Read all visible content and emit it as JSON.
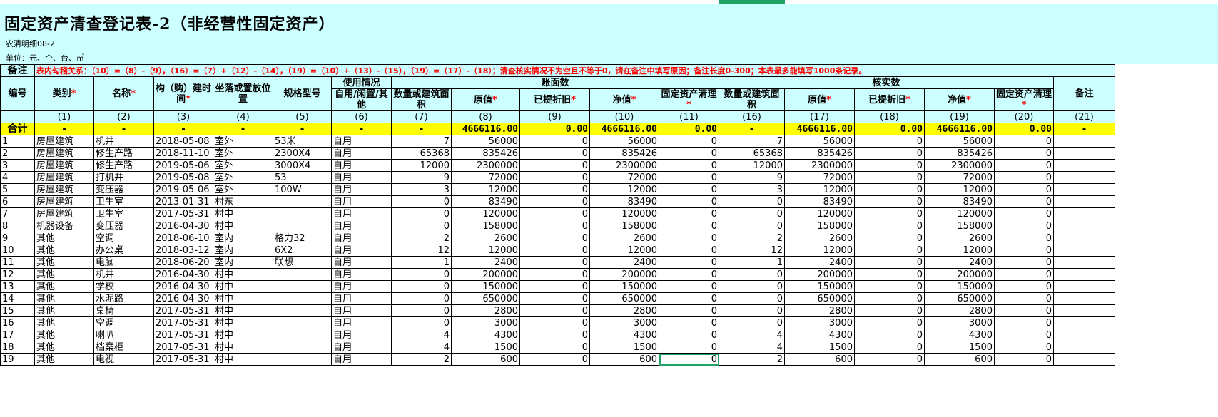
{
  "sheet": {
    "title": "固定资产清查登记表-2（非经营性固定资产）",
    "code": "农清明细08-2",
    "unit": "单位：元、个、台、㎡",
    "note_label": "备注",
    "note_text": "表内勾稽关系：（10）=（8）-（9），（16）=（7）+（12）-（14），（19）=（10）+（13）-（15），（19）=（17）-（18）；清查核实情况不为空且不等于0，请在备注中填写原因；备注长度0-300；本表最多能填写1000条记录。"
  },
  "headers": {
    "no": "编号",
    "category": "类别",
    "name": "名称",
    "build_time": "构（购）建时间",
    "location": "坐落或置放位置",
    "spec": "规格型号",
    "usage_group": "使用情况",
    "usage": "自用/闲置/其他",
    "book_group": "账面数",
    "verify_group": "核实数",
    "qty_book": "数量或建筑面积",
    "orig_book": "原值",
    "dep_book": "已提折旧",
    "net_book": "净值",
    "clean_book": "固定资产清理",
    "qty_ver": "数量或建筑面积",
    "orig_ver": "原值",
    "dep_ver": "已提折旧",
    "net_ver": "净值",
    "clean_ver": "固定资产清理",
    "remark": "备注",
    "star": "*"
  },
  "col_numbers": [
    "",
    "(1)",
    "(2)",
    "(3)",
    "(4)",
    "(5)",
    "(6)",
    "(7)",
    "(8)",
    "(9)",
    "(10)",
    "(11)",
    "(16)",
    "(17)",
    "(18)",
    "(19)",
    "(20)",
    "(21)"
  ],
  "total_row": [
    "合计",
    "-",
    "-",
    "-",
    "-",
    "-",
    "-",
    "-",
    "4666116.00",
    "0.00",
    "4666116.00",
    "0.00",
    "-",
    "4666116.00",
    "0.00",
    "4666116.00",
    "0.00",
    "-"
  ],
  "rows": [
    [
      "1",
      "房屋建筑",
      "机井",
      "2018-05-08",
      "室外",
      "53米",
      "自用",
      "7",
      "56000",
      "0",
      "56000",
      "0",
      "7",
      "56000",
      "0",
      "56000",
      "0",
      ""
    ],
    [
      "2",
      "房屋建筑",
      "修生产路",
      "2018-11-10",
      "室外",
      "2300X4",
      "自用",
      "65368",
      "835426",
      "0",
      "835426",
      "0",
      "65368",
      "835426",
      "0",
      "835426",
      "0",
      ""
    ],
    [
      "3",
      "房屋建筑",
      "修生产路",
      "2019-05-06",
      "室外",
      "3000X4",
      "自用",
      "12000",
      "2300000",
      "0",
      "2300000",
      "0",
      "12000",
      "2300000",
      "0",
      "2300000",
      "0",
      ""
    ],
    [
      "4",
      "房屋建筑",
      "打机井",
      "2019-05-08",
      "室外",
      "53",
      "自用",
      "9",
      "72000",
      "0",
      "72000",
      "0",
      "9",
      "72000",
      "0",
      "72000",
      "0",
      ""
    ],
    [
      "5",
      "房屋建筑",
      "变压器",
      "2019-05-06",
      "室外",
      "100W",
      "自用",
      "3",
      "12000",
      "0",
      "12000",
      "0",
      "3",
      "12000",
      "0",
      "12000",
      "0",
      ""
    ],
    [
      "6",
      "房屋建筑",
      "卫生室",
      "2013-01-31",
      "村东",
      "",
      "自用",
      "0",
      "83490",
      "0",
      "83490",
      "0",
      "0",
      "83490",
      "0",
      "83490",
      "0",
      ""
    ],
    [
      "7",
      "房屋建筑",
      "卫生室",
      "2017-05-31",
      "村中",
      "",
      "自用",
      "0",
      "120000",
      "0",
      "120000",
      "0",
      "0",
      "120000",
      "0",
      "120000",
      "0",
      ""
    ],
    [
      "8",
      "机器设备",
      "变压器",
      "2016-04-30",
      "村中",
      "",
      "自用",
      "0",
      "158000",
      "0",
      "158000",
      "0",
      "0",
      "158000",
      "0",
      "158000",
      "0",
      ""
    ],
    [
      "9",
      "其他",
      "空调",
      "2018-06-10",
      "室内",
      "格力32",
      "自用",
      "2",
      "2600",
      "0",
      "2600",
      "0",
      "2",
      "2600",
      "0",
      "2600",
      "0",
      ""
    ],
    [
      "10",
      "其他",
      "办公桌",
      "2018-03-12",
      "室内",
      "6X2",
      "自用",
      "12",
      "12000",
      "0",
      "12000",
      "0",
      "12",
      "12000",
      "0",
      "12000",
      "0",
      ""
    ],
    [
      "11",
      "其他",
      "电脑",
      "2018-06-20",
      "室内",
      "联想",
      "自用",
      "1",
      "2400",
      "0",
      "2400",
      "0",
      "1",
      "2400",
      "0",
      "2400",
      "0",
      ""
    ],
    [
      "12",
      "其他",
      "机井",
      "2016-04-30",
      "村中",
      "",
      "自用",
      "0",
      "200000",
      "0",
      "200000",
      "0",
      "0",
      "200000",
      "0",
      "200000",
      "0",
      ""
    ],
    [
      "13",
      "其他",
      "学校",
      "2016-04-30",
      "村中",
      "",
      "自用",
      "0",
      "150000",
      "0",
      "150000",
      "0",
      "0",
      "150000",
      "0",
      "150000",
      "0",
      ""
    ],
    [
      "14",
      "其他",
      "水泥路",
      "2016-04-30",
      "村中",
      "",
      "自用",
      "0",
      "650000",
      "0",
      "650000",
      "0",
      "0",
      "650000",
      "0",
      "650000",
      "0",
      ""
    ],
    [
      "15",
      "其他",
      "桌椅",
      "2017-05-31",
      "村中",
      "",
      "自用",
      "0",
      "2800",
      "0",
      "2800",
      "0",
      "0",
      "2800",
      "0",
      "2800",
      "0",
      ""
    ],
    [
      "16",
      "其他",
      "空调",
      "2017-05-31",
      "村中",
      "",
      "自用",
      "0",
      "3000",
      "0",
      "3000",
      "0",
      "0",
      "3000",
      "0",
      "3000",
      "0",
      ""
    ],
    [
      "17",
      "其他",
      "喇叭",
      "2017-05-31",
      "村中",
      "",
      "自用",
      "4",
      "4300",
      "0",
      "4300",
      "0",
      "4",
      "4300",
      "0",
      "4300",
      "0",
      ""
    ],
    [
      "18",
      "其他",
      "档案柜",
      "2017-05-31",
      "村中",
      "",
      "自用",
      "4",
      "1500",
      "0",
      "1500",
      "0",
      "4",
      "1500",
      "0",
      "1500",
      "0",
      ""
    ],
    [
      "19",
      "其他",
      "电视",
      "2017-05-31",
      "村中",
      "",
      "自用",
      "2",
      "600",
      "0",
      "600",
      "0",
      "2",
      "600",
      "0",
      "600",
      "0",
      ""
    ]
  ]
}
